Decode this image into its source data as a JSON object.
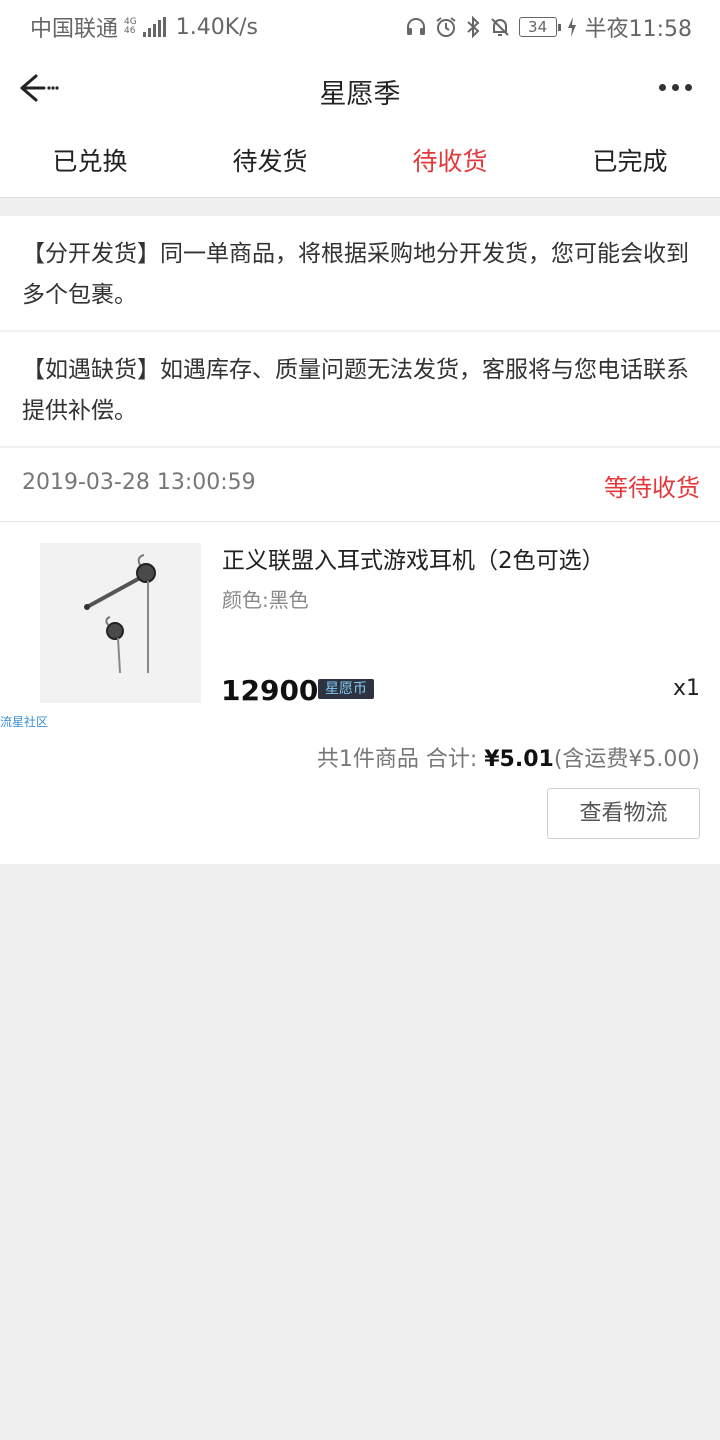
{
  "status_bar": {
    "carrier": "中国联通",
    "network_tag_top": "4G",
    "network_tag_bottom": "46",
    "speed": "1.40K/s",
    "battery": "34",
    "time": "半夜11:58"
  },
  "nav": {
    "title": "星愿季"
  },
  "tabs": [
    {
      "label": "已兑换",
      "active": false
    },
    {
      "label": "待发货",
      "active": false
    },
    {
      "label": "待收货",
      "active": true
    },
    {
      "label": "已完成",
      "active": false
    }
  ],
  "notices": [
    "【分开发货】同一单商品，将根据采购地分开发货，您可能会收到多个包裹。",
    "【如遇缺货】如遇库存、质量问题无法发货，客服将与您电话联系提供补偿。"
  ],
  "order": {
    "time": "2019-03-28 13:00:59",
    "status": "等待收货",
    "product": {
      "name": "正义联盟入耳式游戏耳机（2色可选）",
      "spec": "颜色:黑色",
      "price": "12900",
      "currency_tag": "星愿币",
      "quantity": "x1",
      "watermark": "流星社区"
    },
    "summary": {
      "count_text": "共1件商品 合计: ",
      "total": "¥5.01",
      "shipping_text": "(含运费¥5.00)"
    },
    "logistics_button": "查看物流"
  },
  "colors": {
    "accent": "#e4393c",
    "background": "#f0f0f0"
  }
}
